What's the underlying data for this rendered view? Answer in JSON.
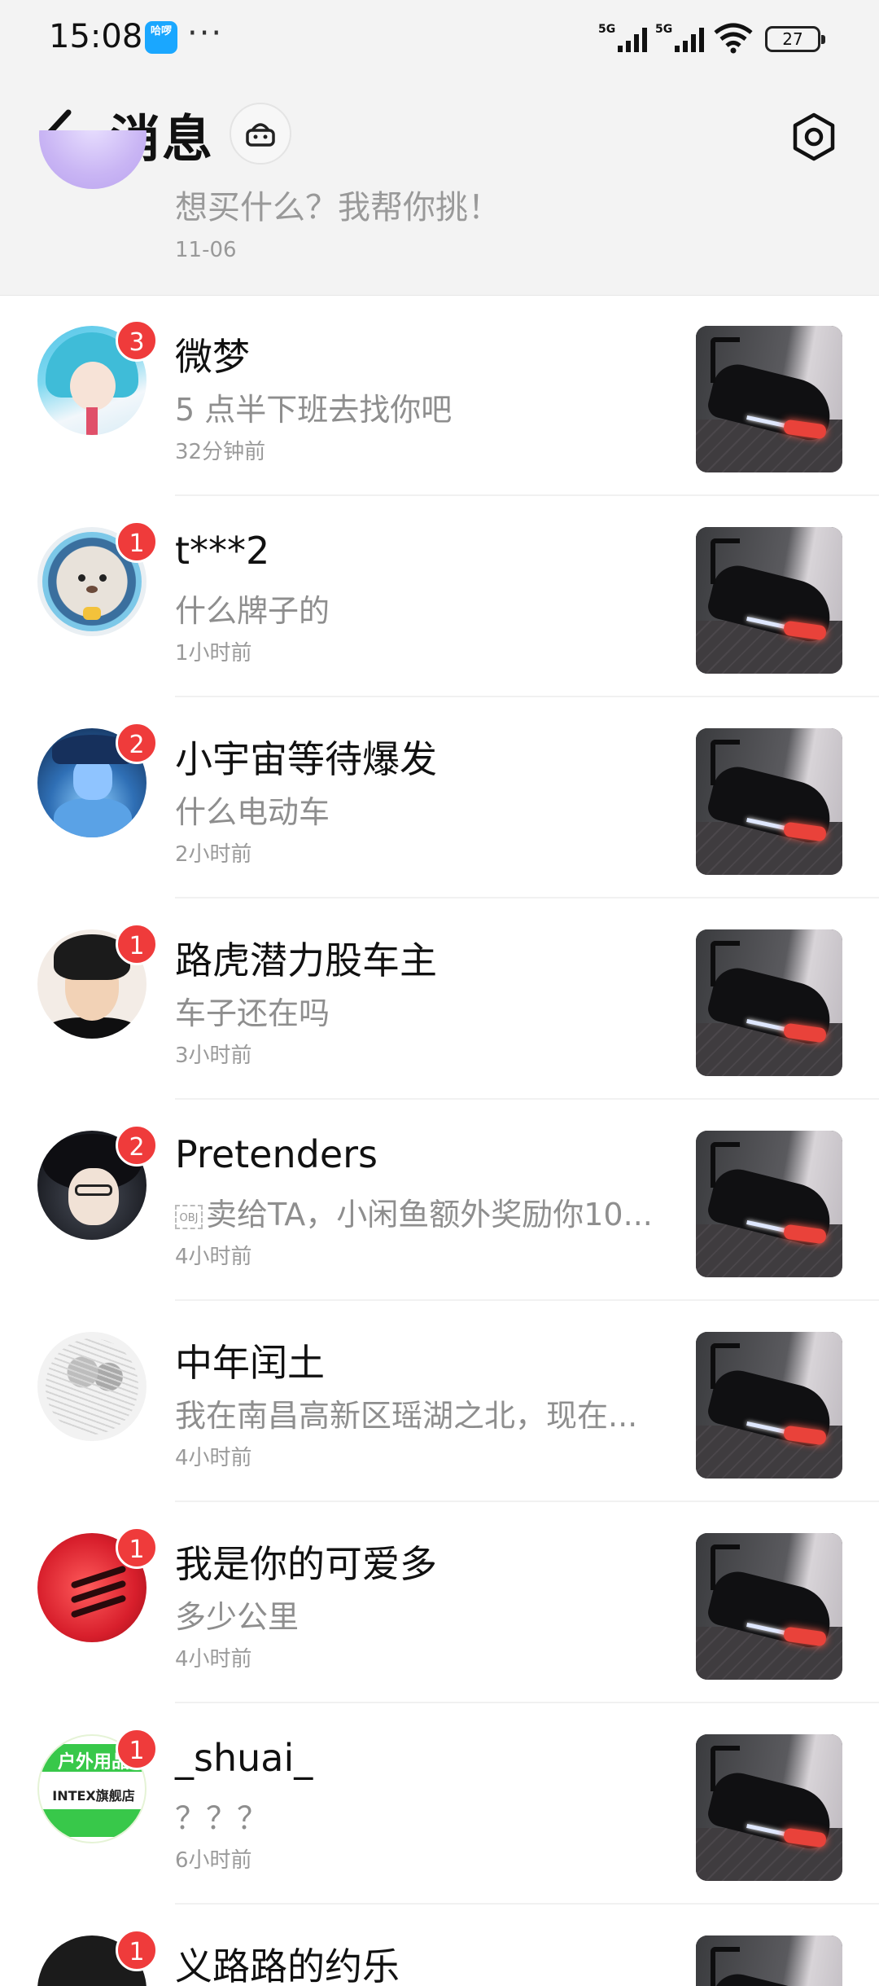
{
  "status_bar": {
    "time": "15:08",
    "app_icon_text": "哈啰",
    "more": "···",
    "network_1": "5G",
    "network_2": "5G",
    "battery": "27"
  },
  "header": {
    "title": "消息",
    "back_icon": "chevron-left-icon",
    "helper_icon": "basket-robot-icon",
    "settings_icon": "hexagon-settings-icon"
  },
  "pinned": {
    "message": "想买什么？我帮你挑！",
    "time": "11-06"
  },
  "conversations": [
    {
      "name": "微梦",
      "badge": "3",
      "message": "5 点半下班去找你吧",
      "time": "32分钟前"
    },
    {
      "name": "t***2",
      "badge": "1",
      "message": "什么牌子的",
      "time": "1小时前"
    },
    {
      "name": "小宇宙等待爆发",
      "badge": "2",
      "message": "什么电动车",
      "time": "2小时前"
    },
    {
      "name": "路虎潜力股车主",
      "badge": "1",
      "message": "车子还在吗",
      "time": "3小时前"
    },
    {
      "name": "Pretenders",
      "badge": "2",
      "message": "卖给TA，小闲鱼额外奖励你10...",
      "obj_text": "OBJ",
      "time": "4小时前"
    },
    {
      "name": "中年闰土",
      "badge": "",
      "message": "我在南昌高新区瑶湖之北，现在...",
      "time": "4小时前"
    },
    {
      "name": "我是你的可爱多",
      "badge": "1",
      "message": "多少公里",
      "time": "4小时前"
    },
    {
      "name": "_shuai_",
      "badge": "1",
      "message": "？？？",
      "time": "6小时前",
      "avatar_text_1": "户外用品",
      "avatar_text_2": "INTEX旗舰店"
    },
    {
      "name": "义路路的约乐",
      "badge": "1"
    }
  ],
  "colors": {
    "badge": "#ef3b3b",
    "header_bg": "#f3f3f3",
    "secondary_text": "#8e8e8e"
  }
}
